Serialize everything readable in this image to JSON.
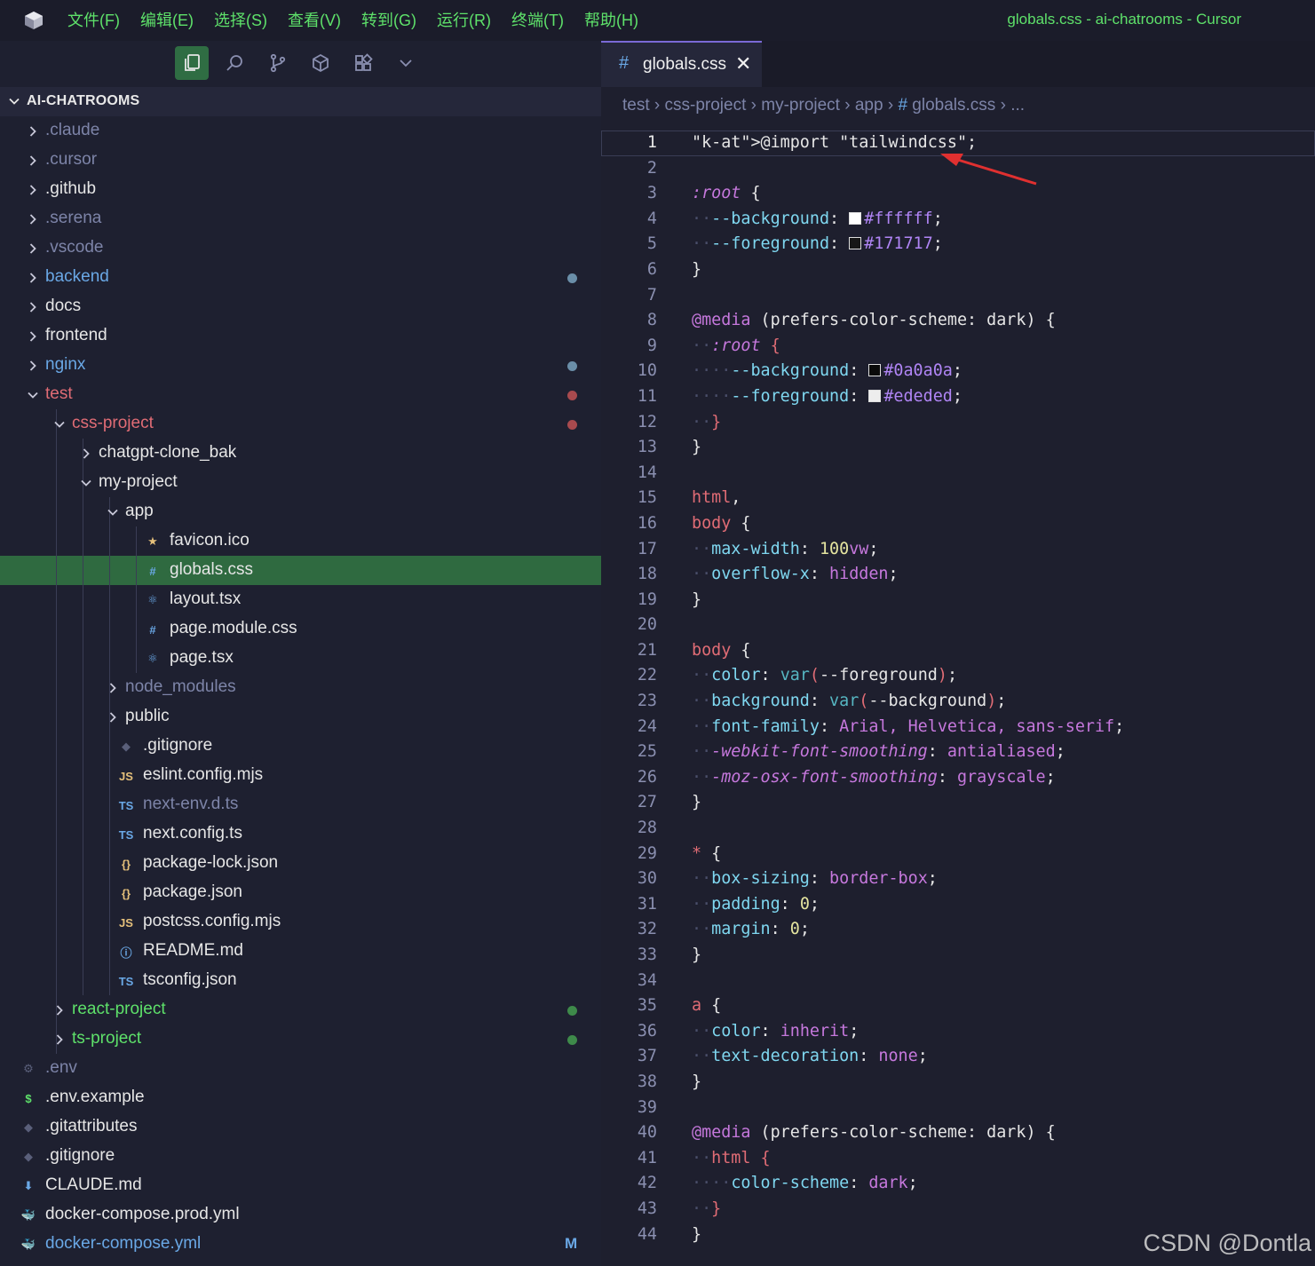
{
  "menus": [
    "文件(F)",
    "编辑(E)",
    "选择(S)",
    "查看(V)",
    "转到(G)",
    "运行(R)",
    "终端(T)",
    "帮助(H)"
  ],
  "window_title": "globals.css - ai-chatrooms - Cursor",
  "explorer": {
    "root": "AI-CHATROOMS",
    "items": [
      {
        "label": ".claude",
        "depth": 0,
        "kind": "folder",
        "open": false,
        "color": "#7d84a8"
      },
      {
        "label": ".cursor",
        "depth": 0,
        "kind": "folder",
        "open": false,
        "color": "#7d84a8"
      },
      {
        "label": ".github",
        "depth": 0,
        "kind": "folder",
        "open": false,
        "color": "#e6e6e6"
      },
      {
        "label": ".serena",
        "depth": 0,
        "kind": "folder",
        "open": false,
        "color": "#7d84a8"
      },
      {
        "label": ".vscode",
        "depth": 0,
        "kind": "folder",
        "open": false,
        "color": "#7d84a8"
      },
      {
        "label": "backend",
        "depth": 0,
        "kind": "folder",
        "open": false,
        "color": "#6aa8e6",
        "dot": "#6a8ea8"
      },
      {
        "label": "docs",
        "depth": 0,
        "kind": "folder",
        "open": false,
        "color": "#e6e6e6"
      },
      {
        "label": "frontend",
        "depth": 0,
        "kind": "folder",
        "open": false,
        "color": "#e6e6e6"
      },
      {
        "label": "nginx",
        "depth": 0,
        "kind": "folder",
        "open": false,
        "color": "#6aa8e6",
        "dot": "#6a8ea8"
      },
      {
        "label": "test",
        "depth": 0,
        "kind": "folder",
        "open": true,
        "color": "#e06c75",
        "dot": "#a84a4e"
      },
      {
        "label": "css-project",
        "depth": 1,
        "kind": "folder",
        "open": true,
        "color": "#e06c75",
        "dot": "#a84a4e"
      },
      {
        "label": "chatgpt-clone_bak",
        "depth": 2,
        "kind": "folder",
        "open": false,
        "color": "#e6e6e6"
      },
      {
        "label": "my-project",
        "depth": 2,
        "kind": "folder",
        "open": true,
        "color": "#e6e6e6"
      },
      {
        "label": "app",
        "depth": 3,
        "kind": "folder",
        "open": true,
        "color": "#e6e6e6"
      },
      {
        "label": "favicon.ico",
        "depth": 4,
        "kind": "file",
        "icon": "★",
        "iconName": "star-icon",
        "iconColor": "#e5c07b",
        "color": "#e6e6e6"
      },
      {
        "label": "globals.css",
        "depth": 4,
        "kind": "file",
        "icon": "#",
        "iconName": "css-hash-icon",
        "iconColor": "#6aa8e6",
        "color": "#e6e6e6",
        "selected": true
      },
      {
        "label": "layout.tsx",
        "depth": 4,
        "kind": "file",
        "icon": "⚛",
        "iconName": "react-icon",
        "iconColor": "#6aa8e6",
        "color": "#e6e6e6"
      },
      {
        "label": "page.module.css",
        "depth": 4,
        "kind": "file",
        "icon": "#",
        "iconName": "css-hash-icon",
        "iconColor": "#6aa8e6",
        "color": "#e6e6e6"
      },
      {
        "label": "page.tsx",
        "depth": 4,
        "kind": "file",
        "icon": "⚛",
        "iconName": "react-icon",
        "iconColor": "#6aa8e6",
        "color": "#e6e6e6"
      },
      {
        "label": "node_modules",
        "depth": 3,
        "kind": "folder",
        "open": false,
        "color": "#7d84a8"
      },
      {
        "label": "public",
        "depth": 3,
        "kind": "folder",
        "open": false,
        "color": "#e6e6e6"
      },
      {
        "label": ".gitignore",
        "depth": 3,
        "kind": "file",
        "icon": "◆",
        "iconName": "git-icon",
        "iconColor": "#5a5f7a",
        "color": "#e6e6e6"
      },
      {
        "label": "eslint.config.mjs",
        "depth": 3,
        "kind": "file",
        "icon": "JS",
        "iconName": "js-icon",
        "iconColor": "#e5c07b",
        "color": "#e6e6e6"
      },
      {
        "label": "next-env.d.ts",
        "depth": 3,
        "kind": "file",
        "icon": "TS",
        "iconName": "ts-icon",
        "iconColor": "#6aa8e6",
        "color": "#7d84a8"
      },
      {
        "label": "next.config.ts",
        "depth": 3,
        "kind": "file",
        "icon": "TS",
        "iconName": "ts-icon",
        "iconColor": "#6aa8e6",
        "color": "#e6e6e6"
      },
      {
        "label": "package-lock.json",
        "depth": 3,
        "kind": "file",
        "icon": "{}",
        "iconName": "json-icon",
        "iconColor": "#e5c07b",
        "color": "#e6e6e6"
      },
      {
        "label": "package.json",
        "depth": 3,
        "kind": "file",
        "icon": "{}",
        "iconName": "json-icon",
        "iconColor": "#e5c07b",
        "color": "#e6e6e6"
      },
      {
        "label": "postcss.config.mjs",
        "depth": 3,
        "kind": "file",
        "icon": "JS",
        "iconName": "js-icon",
        "iconColor": "#e5c07b",
        "color": "#e6e6e6"
      },
      {
        "label": "README.md",
        "depth": 3,
        "kind": "file",
        "icon": "ⓘ",
        "iconName": "info-icon",
        "iconColor": "#6aa8e6",
        "color": "#e6e6e6"
      },
      {
        "label": "tsconfig.json",
        "depth": 3,
        "kind": "file",
        "icon": "TS",
        "iconName": "tsconfig-icon",
        "iconColor": "#6aa8e6",
        "color": "#e6e6e6"
      },
      {
        "label": "react-project",
        "depth": 1,
        "kind": "folder",
        "open": false,
        "color": "#5ee16a",
        "dot": "#3e8a4a"
      },
      {
        "label": "ts-project",
        "depth": 1,
        "kind": "folder",
        "open": false,
        "color": "#5ee16a",
        "dot": "#3e8a4a"
      },
      {
        "label": ".env",
        "depth": 0,
        "kind": "file",
        "icon": "⚙",
        "iconName": "gear-icon",
        "iconColor": "#5a5f7a",
        "color": "#7d84a8",
        "rootfile": true
      },
      {
        "label": ".env.example",
        "depth": 0,
        "kind": "file",
        "icon": "$",
        "iconName": "dollar-icon",
        "iconColor": "#5ee16a",
        "color": "#e6e6e6",
        "rootfile": true
      },
      {
        "label": ".gitattributes",
        "depth": 0,
        "kind": "file",
        "icon": "◆",
        "iconName": "git-icon",
        "iconColor": "#5a5f7a",
        "color": "#e6e6e6",
        "rootfile": true
      },
      {
        "label": ".gitignore",
        "depth": 0,
        "kind": "file",
        "icon": "◆",
        "iconName": "git-icon",
        "iconColor": "#5a5f7a",
        "color": "#e6e6e6",
        "rootfile": true
      },
      {
        "label": "CLAUDE.md",
        "depth": 0,
        "kind": "file",
        "icon": "⬇",
        "iconName": "markdown-icon",
        "iconColor": "#6aa8e6",
        "color": "#e6e6e6",
        "rootfile": true
      },
      {
        "label": "docker-compose.prod.yml",
        "depth": 0,
        "kind": "file",
        "icon": "🐳",
        "iconName": "docker-icon",
        "iconColor": "#e06c75",
        "color": "#e6e6e6",
        "rootfile": true
      },
      {
        "label": "docker-compose.yml",
        "depth": 0,
        "kind": "file",
        "icon": "🐳",
        "iconName": "docker-icon",
        "iconColor": "#e06c75",
        "color": "#6aa8e6",
        "rootfile": true,
        "mark": "M"
      }
    ]
  },
  "tab": {
    "hash": "#",
    "name": "globals.css",
    "close": "✕"
  },
  "breadcrumbs": [
    "test",
    "css-project",
    "my-project",
    "app",
    "globals.css",
    "..."
  ],
  "code_lines": [
    "@import \"tailwindcss\";",
    "",
    ":root {",
    "  --background: #ffffff;",
    "  --foreground: #171717;",
    "}",
    "",
    "@media (prefers-color-scheme: dark) {",
    "  :root {",
    "    --background: #0a0a0a;",
    "    --foreground: #ededed;",
    "  }",
    "}",
    "",
    "html,",
    "body {",
    "  max-width: 100vw;",
    "  overflow-x: hidden;",
    "}",
    "",
    "body {",
    "  color: var(--foreground);",
    "  background: var(--background);",
    "  font-family: Arial, Helvetica, sans-serif;",
    "  -webkit-font-smoothing: antialiased;",
    "  -moz-osx-font-smoothing: grayscale;",
    "}",
    "",
    "* {",
    "  box-sizing: border-box;",
    "  padding: 0;",
    "  margin: 0;",
    "}",
    "",
    "a {",
    "  color: inherit;",
    "  text-decoration: none;",
    "}",
    "",
    "@media (prefers-color-scheme: dark) {",
    "  html {",
    "    color-scheme: dark;",
    "  }",
    "}"
  ],
  "current_line": 1,
  "watermark": "CSDN @Dontla"
}
